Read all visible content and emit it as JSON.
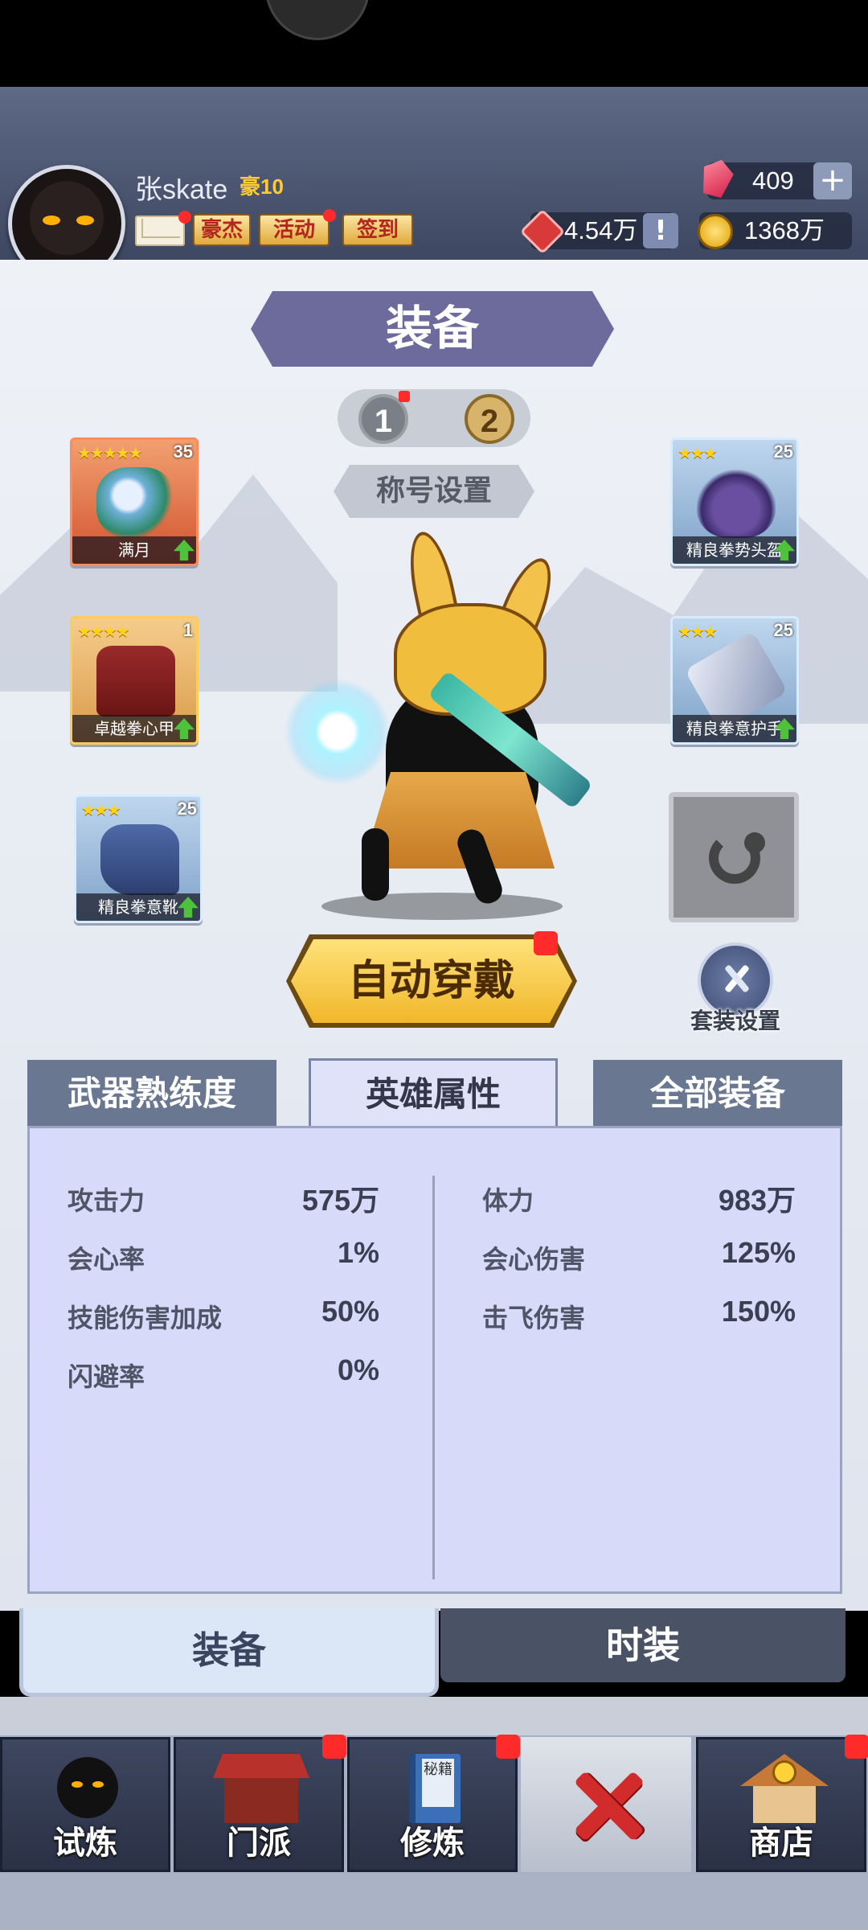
{
  "header": {
    "player_name": "张skate",
    "vip_label": "豪10",
    "buttons": [
      {
        "label": "豪杰"
      },
      {
        "label": "活动"
      },
      {
        "label": "签到"
      }
    ],
    "gems": "409",
    "tickets": "4.54万",
    "coins": "1368万"
  },
  "main": {
    "title": "装备",
    "pages": [
      "1",
      "2"
    ],
    "title_setting": "称号设置",
    "auto_wear": "自动穿戴",
    "suit_setting": "套装设置"
  },
  "slots": [
    {
      "name": "满月",
      "stars": "★★★★★",
      "level": "35",
      "rarity": "red"
    },
    {
      "name": "卓越拳心甲",
      "stars": "★★★★",
      "level": "1",
      "rarity": "orange"
    },
    {
      "name": "精良拳意靴",
      "stars": "★★★",
      "level": "25",
      "rarity": "blue"
    },
    {
      "name": "精良拳势头盔",
      "stars": "★★★",
      "level": "25",
      "rarity": "blue"
    },
    {
      "name": "精良拳意护手",
      "stars": "★★★",
      "level": "25",
      "rarity": "blue"
    }
  ],
  "stat_tabs": [
    "武器熟练度",
    "英雄属性",
    "全部装备"
  ],
  "stats_left": [
    {
      "label": "攻击力",
      "value": "575万"
    },
    {
      "label": "会心率",
      "value": "1%"
    },
    {
      "label": "技能伤害加成",
      "value": "50%"
    },
    {
      "label": "闪避率",
      "value": "0%"
    }
  ],
  "stats_right": [
    {
      "label": "体力",
      "value": "983万"
    },
    {
      "label": "会心伤害",
      "value": "125%"
    },
    {
      "label": "击飞伤害",
      "value": "150%"
    }
  ],
  "sub_tabs": [
    "装备",
    "时装"
  ],
  "bottom_nav": [
    {
      "label": "试炼"
    },
    {
      "label": "门派"
    },
    {
      "label": "修炼"
    },
    {
      "label": "商店"
    }
  ],
  "colors": {
    "header_bg": "#4c5672",
    "accent_gold": "#f0b72a",
    "badge_red": "#ff2a2a",
    "tab_active": "#dfe2f8",
    "tab_inactive": "#697790"
  }
}
